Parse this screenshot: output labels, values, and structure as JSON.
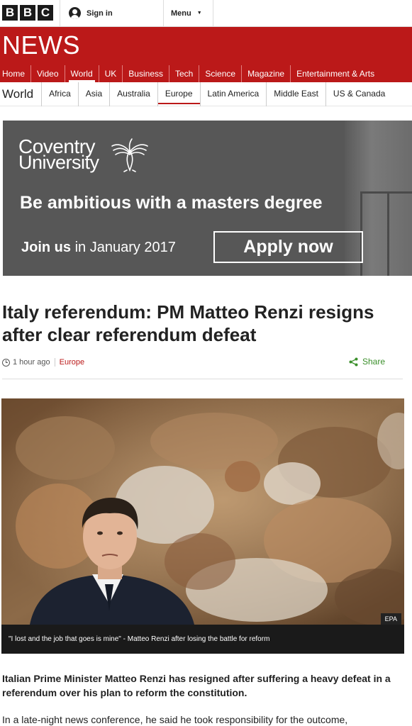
{
  "header": {
    "bbc_letters": [
      "B",
      "B",
      "C"
    ],
    "signin_label": "Sign in",
    "menu_label": "Menu"
  },
  "brand": {
    "news_label": "NEWS",
    "color": "#bb1919"
  },
  "primary_nav": [
    {
      "label": "Home",
      "active": false
    },
    {
      "label": "Video",
      "active": false
    },
    {
      "label": "World",
      "active": true
    },
    {
      "label": "UK",
      "active": false
    },
    {
      "label": "Business",
      "active": false
    },
    {
      "label": "Tech",
      "active": false
    },
    {
      "label": "Science",
      "active": false
    },
    {
      "label": "Magazine",
      "active": false
    },
    {
      "label": "Entertainment & Arts",
      "active": false
    }
  ],
  "secondary_nav": {
    "section_title": "World",
    "items": [
      {
        "label": "Africa",
        "active": false
      },
      {
        "label": "Asia",
        "active": false
      },
      {
        "label": "Australia",
        "active": false
      },
      {
        "label": "Europe",
        "active": true
      },
      {
        "label": "Latin America",
        "active": false
      },
      {
        "label": "Middle East",
        "active": false
      },
      {
        "label": "US & Canada",
        "active": false
      }
    ]
  },
  "ad": {
    "logo_line1": "Coventry",
    "logo_line2": "University",
    "headline": "Be ambitious with a masters degree",
    "join_bold": "Join us",
    "join_rest": " in January 2017",
    "cta": "Apply now"
  },
  "article": {
    "headline": "Italy referendum: PM Matteo Renzi resigns after clear referendum defeat",
    "timestamp": "1 hour ago",
    "section": "Europe",
    "share_label": "Share",
    "image_credit": "EPA",
    "caption": "\"I lost and the job that goes is mine\" - Matteo Renzi after losing the battle for reform",
    "intro": "Italian Prime Minister Matteo Renzi has resigned after suffering a heavy defeat in a referendum over his plan to reform the constitution.",
    "body_first_line": "In a late-night news conference, he said he took responsibility for the outcome,"
  }
}
